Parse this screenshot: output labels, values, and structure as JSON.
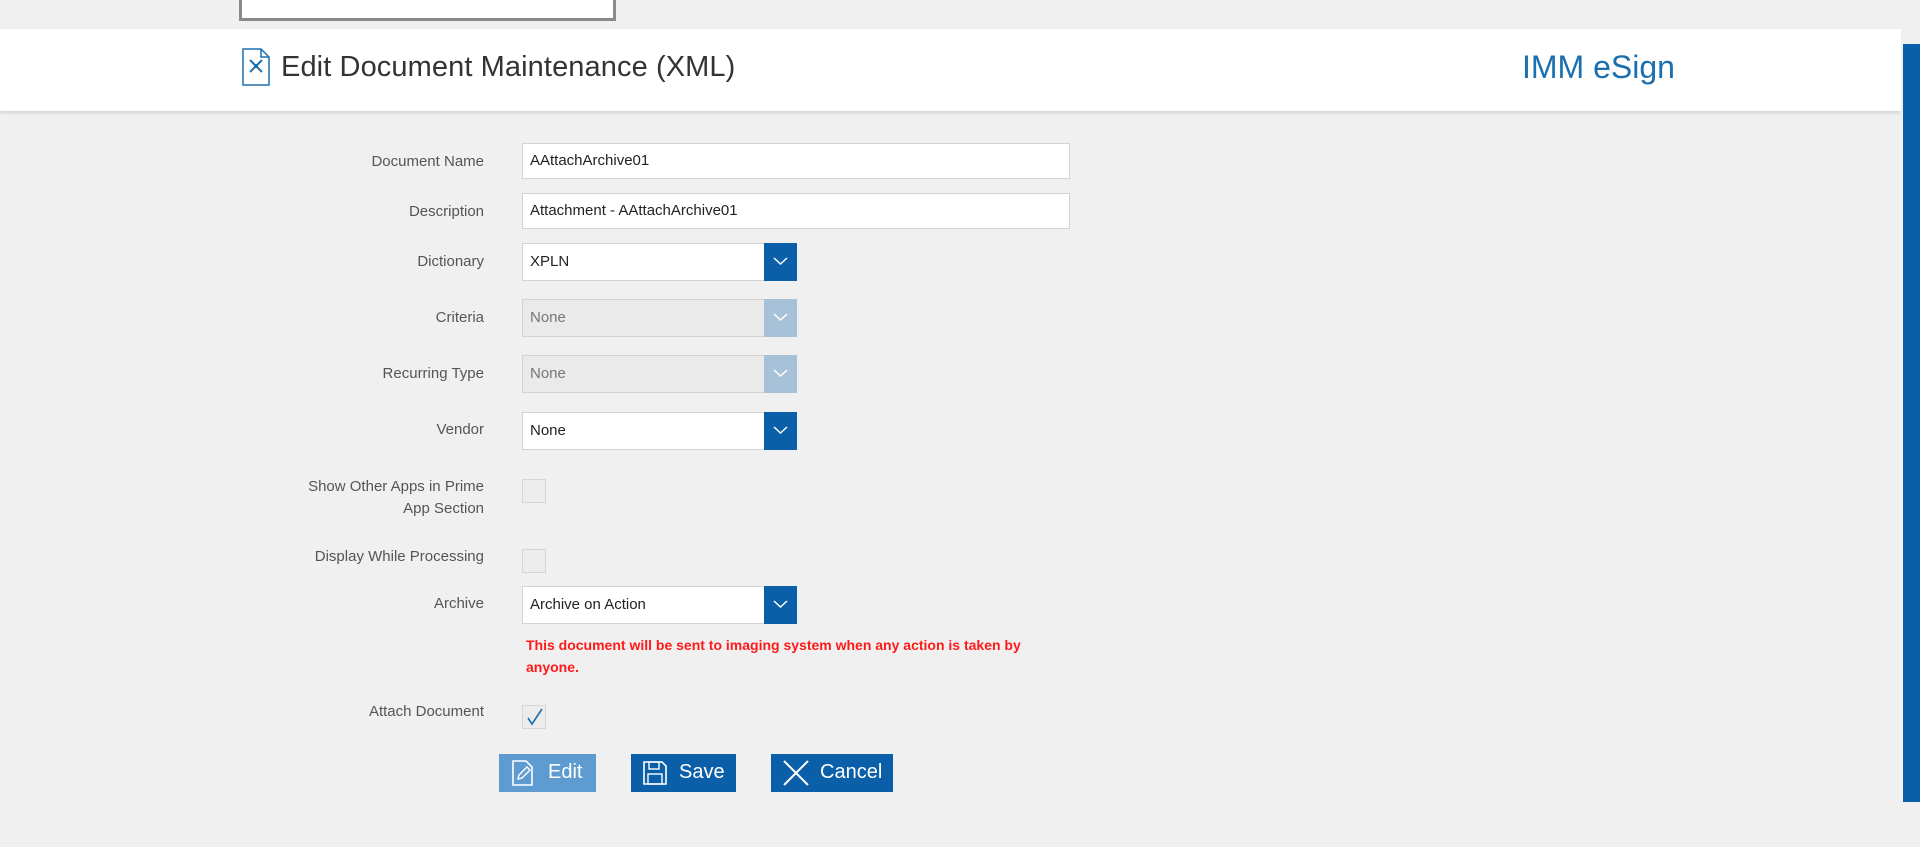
{
  "header": {
    "title": "Edit Document Maintenance (XML)",
    "brand": "IMM eSign"
  },
  "form": {
    "document_name": {
      "label": "Document Name",
      "value": "AAttachArchive01"
    },
    "description": {
      "label": "Description",
      "value": "Attachment  - AAttachArchive01"
    },
    "dictionary": {
      "label": "Dictionary",
      "value": "XPLN"
    },
    "criteria": {
      "label": "Criteria",
      "value": "None",
      "disabled": true
    },
    "recurring_type": {
      "label": "Recurring Type",
      "value": "None",
      "disabled": true
    },
    "vendor": {
      "label": "Vendor",
      "value": "None"
    },
    "show_other_apps": {
      "label": "Show Other Apps in Prime App Section",
      "checked": false
    },
    "display_while_processing": {
      "label": "Display While Processing",
      "checked": false
    },
    "archive": {
      "label": "Archive",
      "value": "Archive on Action",
      "warning": "This document will be sent to imaging system when any action is taken by anyone."
    },
    "attach_document": {
      "label": "Attach Document",
      "checked": true
    }
  },
  "buttons": {
    "edit": "Edit",
    "save": "Save",
    "cancel": "Cancel"
  },
  "colors": {
    "accent": "#0b5fa8",
    "accent_light": "#5d9bd0",
    "warning": "#ff1a1a",
    "brand": "#1a6fae"
  }
}
